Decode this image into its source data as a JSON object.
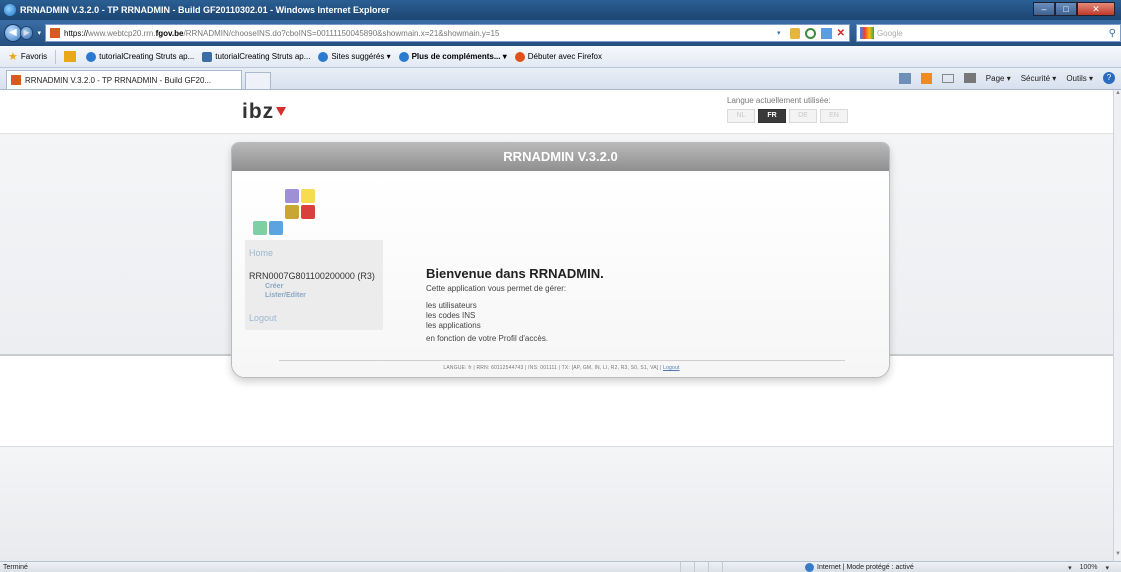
{
  "window": {
    "title": "RRNADMIN V.3.2.0 - TP RRNADMIN - Build GF20110302.01 - Windows Internet Explorer"
  },
  "address": {
    "protocol": "https://",
    "host_prefix": "www.webtcp20.rrn.",
    "domain": "fgov.be",
    "path": "/RRNADMIN/chooseINS.do?cboINS=00111150045890&showmain.x=21&showmain.y=15",
    "search_placeholder": "Google"
  },
  "favorites": {
    "label": "Favoris",
    "items": [
      "tutorialCreating Struts ap...",
      "tutorialCreating Struts ap...",
      "Sites suggérés ▾",
      "Plus de compléments... ▾",
      "Débuter avec Firefox"
    ]
  },
  "tabs": {
    "active": "RRNADMIN V.3.2.0 - TP RRNADMIN - Build GF20..."
  },
  "commandbar": {
    "page": "Page ▾",
    "security": "Sécurité ▾",
    "tools": "Outils ▾"
  },
  "header": {
    "logo": "ibz",
    "lang_label": "Langue actuellement utilisée:",
    "langs": [
      "NL",
      "FR",
      "DE",
      "EN"
    ],
    "active_lang": "FR"
  },
  "panel": {
    "title": "RRNADMIN V.3.2.0",
    "squares_colors": [
      "#9f8fd6",
      "#f6dc4e",
      "#c9a633",
      "#d9403b",
      "#7fcfa5",
      "#5ba4e0"
    ],
    "nav": {
      "home": "Home",
      "id": "RRN0007G801100200000 (R3)",
      "create": "Créer",
      "list_edit": "Lister/Editer",
      "logout": "Logout"
    },
    "welcome": "Bienvenue dans RRNADMIN.",
    "intro": "Cette application vous permet de gérer:",
    "rights": [
      "les utilisateurs",
      "les codes INS",
      "les applications"
    ],
    "profile": "en fonction de votre Profil d'accès.",
    "footer": "LANGUE: fr | RRN: 60112544743 | INS: 001111 | TX: [AP, GM, IN, LI, R2, R3, S0, S1, VA] |",
    "footer_link": "Logout"
  },
  "status": {
    "text": "Terminé",
    "zone": "Internet | Mode protégé : activé",
    "zoom": "100%"
  }
}
